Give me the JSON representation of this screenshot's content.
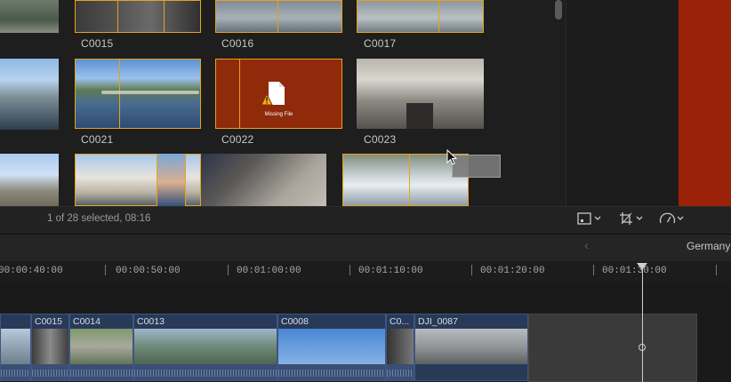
{
  "browser": {
    "clips": [
      {
        "name": "C0015"
      },
      {
        "name": "C0016"
      },
      {
        "name": "C0017"
      },
      {
        "name": "C0021"
      },
      {
        "name": "C0022",
        "missing_text": "Missing File"
      },
      {
        "name": "C0023"
      }
    ]
  },
  "status": {
    "text": "1 of 28 selected, 08:16"
  },
  "timeline": {
    "project": "Germany",
    "ruler": [
      "00:00:40:00",
      "00:00:50:00",
      "00:01:00:00",
      "00:01:10:00",
      "00:01:20:00",
      "00:01:30:00"
    ],
    "clips": [
      {
        "label": ""
      },
      {
        "label": "C0015"
      },
      {
        "label": "C0014"
      },
      {
        "label": "C0013"
      },
      {
        "label": "C0008"
      },
      {
        "label": "C0..."
      },
      {
        "label": "DJI_0087"
      }
    ]
  },
  "colors": {
    "selection": "#e6a31a",
    "missing_clip": "#8f2a0a",
    "timeline_clip": "#283a57"
  }
}
